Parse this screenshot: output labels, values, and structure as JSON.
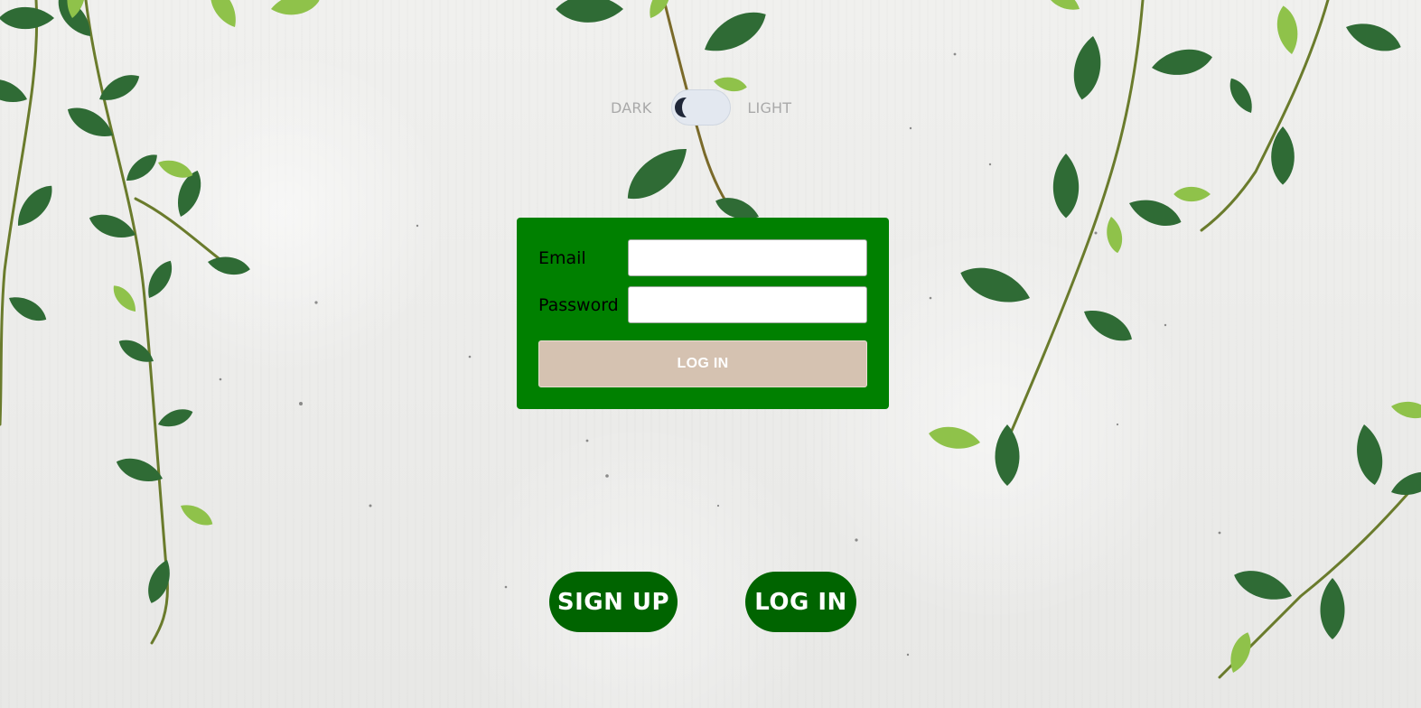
{
  "theme_toggle": {
    "dark_label": "DARK",
    "light_label": "LIGHT",
    "state": "dark"
  },
  "login_form": {
    "email_label": "Email",
    "email_value": "",
    "password_label": "Password",
    "password_value": "",
    "submit_label": "LOG IN"
  },
  "actions": {
    "signup_label": "SIGN UP",
    "login_label": "LOG IN"
  },
  "colors": {
    "card_green": "#008000",
    "pill_green": "#006400",
    "submit_beige": "#d5c2b1",
    "toggle_track": "#e3e8f0",
    "toggle_knob": "#1f2738",
    "leaf_dark": "#1f5a2e",
    "leaf_light": "#8fc24a"
  },
  "background": {
    "icon": "hanging-vines-on-concrete-wall"
  }
}
